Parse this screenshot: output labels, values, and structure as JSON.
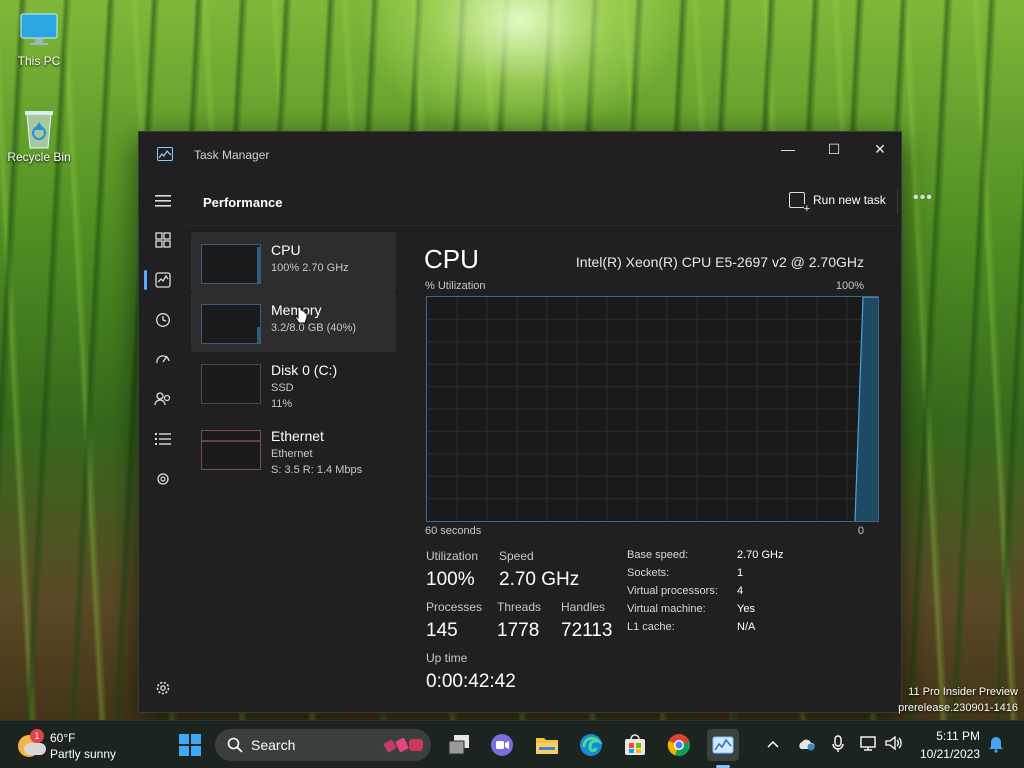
{
  "desktop": {
    "icons": [
      {
        "label": "This PC"
      },
      {
        "label": "Recycle Bin"
      }
    ],
    "watermark": {
      "line1": "11 Pro Insider Preview",
      "line2": "prerelease.230901-1416"
    }
  },
  "window": {
    "title": "Task Manager",
    "controls": {
      "minimize": "—",
      "maximize": "☐",
      "close": "✕"
    }
  },
  "header": {
    "title": "Performance",
    "run_new_task": "Run new task",
    "more": "•••"
  },
  "devices": [
    {
      "name": "CPU",
      "line1": "100% 2.70 GHz",
      "line2": ""
    },
    {
      "name": "Memory",
      "line1": "3.2/8.0 GB (40%)",
      "line2": ""
    },
    {
      "name": "Disk 0 (C:)",
      "line1": "SSD",
      "line2": "11%"
    },
    {
      "name": "Ethernet",
      "line1": "Ethernet",
      "line2": "S: 3.5  R: 1.4 Mbps"
    }
  ],
  "cpu": {
    "heading": "CPU",
    "model": "Intel(R) Xeon(R) CPU E5-2697 v2 @ 2.70GHz",
    "util_label": "% Utilization",
    "util_max": "100%",
    "axis_left": "60 seconds",
    "axis_right": "0",
    "stats": {
      "utilization_label": "Utilization",
      "utilization": "100%",
      "speed_label": "Speed",
      "speed": "2.70 GHz",
      "processes_label": "Processes",
      "processes": "145",
      "threads_label": "Threads",
      "threads": "1778",
      "handles_label": "Handles",
      "handles": "72113",
      "uptime_label": "Up time",
      "uptime": "0:00:42:42"
    },
    "specs": [
      {
        "key": "Base speed:",
        "value": "2.70 GHz"
      },
      {
        "key": "Sockets:",
        "value": "1"
      },
      {
        "key": "Virtual processors:",
        "value": "4"
      },
      {
        "key": "Virtual machine:",
        "value": "Yes"
      },
      {
        "key": "L1 cache:",
        "value": "N/A"
      }
    ]
  },
  "taskbar": {
    "weather": {
      "temp": "60°F",
      "condition": "Partly sunny",
      "badge": "1"
    },
    "search_label": "Search",
    "clock": {
      "time": "5:11 PM",
      "date": "10/21/2023"
    }
  },
  "colors": {
    "accent": "#5aa9ff",
    "graph_border": "#3e6a8a",
    "graph_fill": "#1f4a63",
    "window_bg": "#202020"
  }
}
